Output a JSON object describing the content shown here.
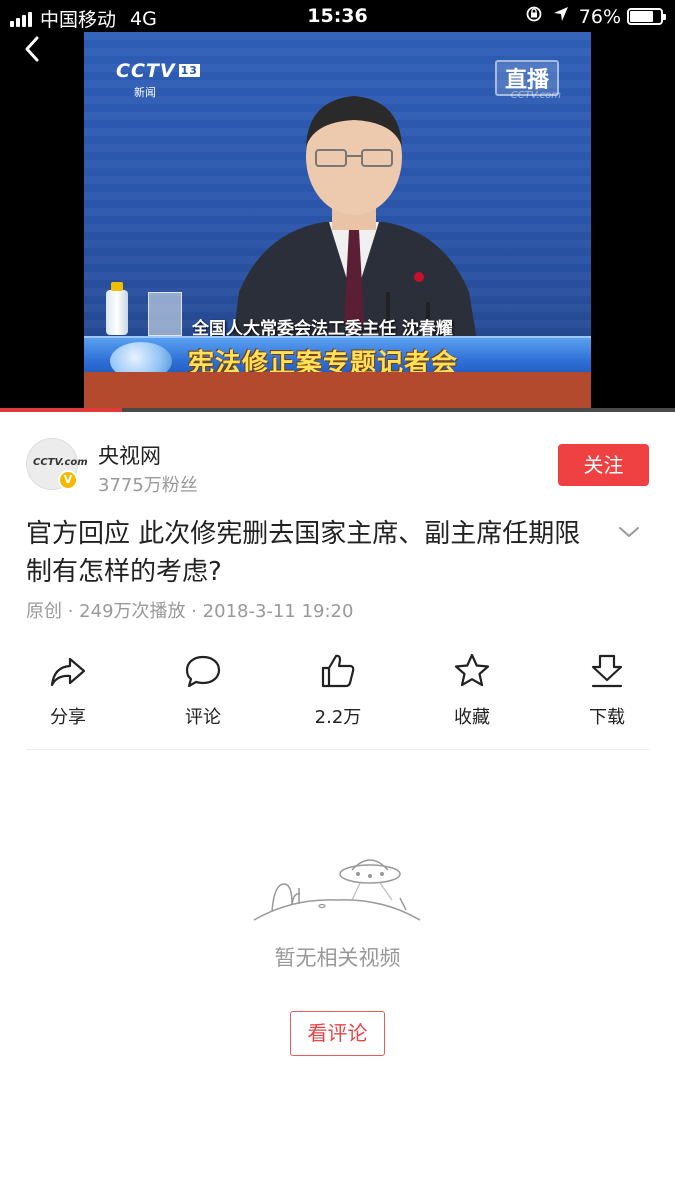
{
  "status_bar": {
    "carrier": "中国移动",
    "network": "4G",
    "time": "15:36",
    "battery_percent": "76%",
    "battery_level": 0.76
  },
  "video": {
    "channel_logo": "CCTV",
    "channel_number": "13",
    "channel_sub": "新闻",
    "live_label": "直播",
    "live_sub": "CCTV.com",
    "caption_name": "全国人大常委会法工委主任 沈春耀",
    "caption_title": "宪法修正案专题记者会",
    "progress": 0.18
  },
  "author": {
    "avatar_logo": "CCTV.com",
    "name": "央视网",
    "fans": "3775万粉丝",
    "follow_label": "关注",
    "verified_mark": "V"
  },
  "post": {
    "title": "官方回应 此次修宪删去国家主席、副主席任期限制有怎样的考虑?",
    "meta": "原创 · 249万次播放 · 2018-3-11 19:20"
  },
  "actions": [
    {
      "icon": "share-icon",
      "label": "分享"
    },
    {
      "icon": "comment-icon",
      "label": "评论"
    },
    {
      "icon": "like-icon",
      "label": "2.2万"
    },
    {
      "icon": "star-icon",
      "label": "收藏"
    },
    {
      "icon": "download-icon",
      "label": "下载"
    }
  ],
  "empty_state": {
    "icon": "ufo-icon",
    "text": "暂无相关视频",
    "button_label": "看评论"
  },
  "colors": {
    "accent": "#f04142",
    "muted_text": "#999999",
    "progress": "#e0393c"
  }
}
